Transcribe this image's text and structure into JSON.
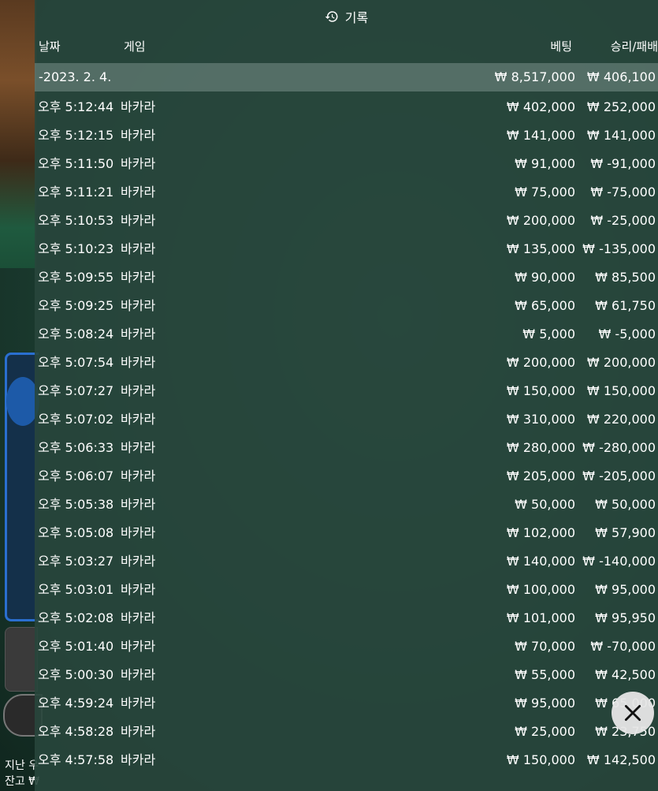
{
  "panel": {
    "title": "기록",
    "columns": {
      "date": "날짜",
      "game": "게임",
      "bet": "베팅",
      "winloss": "승리/패배"
    },
    "date_group": {
      "date": "-2023. 2. 4.",
      "bet": "₩ 8,517,000",
      "winloss": "₩ 406,100"
    },
    "rows": [
      {
        "time": "오후 5:12:44",
        "game": "바카라",
        "bet": "₩ 402,000",
        "winloss": "₩ 252,000"
      },
      {
        "time": "오후 5:12:15",
        "game": "바카라",
        "bet": "₩ 141,000",
        "winloss": "₩ 141,000"
      },
      {
        "time": "오후 5:11:50",
        "game": "바카라",
        "bet": "₩ 91,000",
        "winloss": "₩ -91,000"
      },
      {
        "time": "오후 5:11:21",
        "game": "바카라",
        "bet": "₩ 75,000",
        "winloss": "₩ -75,000"
      },
      {
        "time": "오후 5:10:53",
        "game": "바카라",
        "bet": "₩ 200,000",
        "winloss": "₩ -25,000"
      },
      {
        "time": "오후 5:10:23",
        "game": "바카라",
        "bet": "₩ 135,000",
        "winloss": "₩ -135,000"
      },
      {
        "time": "오후 5:09:55",
        "game": "바카라",
        "bet": "₩ 90,000",
        "winloss": "₩ 85,500"
      },
      {
        "time": "오후 5:09:25",
        "game": "바카라",
        "bet": "₩ 65,000",
        "winloss": "₩ 61,750"
      },
      {
        "time": "오후 5:08:24",
        "game": "바카라",
        "bet": "₩ 5,000",
        "winloss": "₩ -5,000"
      },
      {
        "time": "오후 5:07:54",
        "game": "바카라",
        "bet": "₩ 200,000",
        "winloss": "₩ 200,000"
      },
      {
        "time": "오후 5:07:27",
        "game": "바카라",
        "bet": "₩ 150,000",
        "winloss": "₩ 150,000"
      },
      {
        "time": "오후 5:07:02",
        "game": "바카라",
        "bet": "₩ 310,000",
        "winloss": "₩ 220,000"
      },
      {
        "time": "오후 5:06:33",
        "game": "바카라",
        "bet": "₩ 280,000",
        "winloss": "₩ -280,000"
      },
      {
        "time": "오후 5:06:07",
        "game": "바카라",
        "bet": "₩ 205,000",
        "winloss": "₩ -205,000"
      },
      {
        "time": "오후 5:05:38",
        "game": "바카라",
        "bet": "₩ 50,000",
        "winloss": "₩ 50,000"
      },
      {
        "time": "오후 5:05:08",
        "game": "바카라",
        "bet": "₩ 102,000",
        "winloss": "₩ 57,900"
      },
      {
        "time": "오후 5:03:27",
        "game": "바카라",
        "bet": "₩ 140,000",
        "winloss": "₩ -140,000"
      },
      {
        "time": "오후 5:03:01",
        "game": "바카라",
        "bet": "₩ 100,000",
        "winloss": "₩ 95,000"
      },
      {
        "time": "오후 5:02:08",
        "game": "바카라",
        "bet": "₩ 101,000",
        "winloss": "₩ 95,950"
      },
      {
        "time": "오후 5:01:40",
        "game": "바카라",
        "bet": "₩ 70,000",
        "winloss": "₩ -70,000"
      },
      {
        "time": "오후 5:00:30",
        "game": "바카라",
        "bet": "₩ 55,000",
        "winloss": "₩ 42,500"
      },
      {
        "time": "오후 4:59:24",
        "game": "바카라",
        "bet": "₩ 95,000",
        "winloss": "₩ 65,000"
      },
      {
        "time": "오후 4:58:28",
        "game": "바카라",
        "bet": "₩ 25,000",
        "winloss": "₩ 23,750"
      },
      {
        "time": "오후 4:57:58",
        "game": "바카라",
        "bet": "₩ 150,000",
        "winloss": "₩ 142,500"
      }
    ]
  },
  "background": {
    "left_text_1": "지난 우",
    "left_text_2": "잔고 ₩"
  },
  "icons": {
    "history": "history-icon",
    "close": "close-icon"
  },
  "colors": {
    "panel_bg": "#284640",
    "date_row_bg": "#8ca09b",
    "text": "#ffffff",
    "close_btn_bg": "#e6e6e6"
  }
}
